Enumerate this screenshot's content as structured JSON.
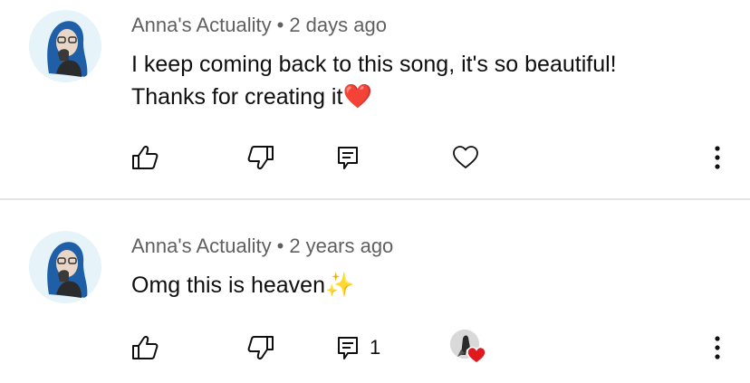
{
  "comments": [
    {
      "author": "Anna's Actuality",
      "separator": "•",
      "time": "2 days ago",
      "text_line1": "I keep coming back to this song, it's so beautiful!",
      "text_line2": "Thanks for creating it",
      "emoji": "❤️",
      "reply_count": "",
      "avatar_icon": "user-avatar-icon",
      "hearted_by_creator": false
    },
    {
      "author": "Anna's Actuality",
      "separator": "•",
      "time": "2 years ago",
      "text_line1": "Omg this is heaven",
      "emoji": "✨",
      "reply_count": "1",
      "avatar_icon": "user-avatar-icon",
      "hearted_by_creator": true
    }
  ],
  "colors": {
    "meta": "#606060",
    "text": "#0f0f0f",
    "divider": "#e5e5e5",
    "avatar_bg": "#e6f4fa",
    "heart_red": "#e0191f",
    "hair_blue": "#1f5fa8"
  },
  "icons": {
    "like": "thumbs-up-icon",
    "dislike": "thumbs-down-icon",
    "reply": "reply-icon",
    "heart": "heart-outline-icon",
    "more": "more-vertical-icon",
    "creator_heart": "creator-heart-badge-icon"
  }
}
